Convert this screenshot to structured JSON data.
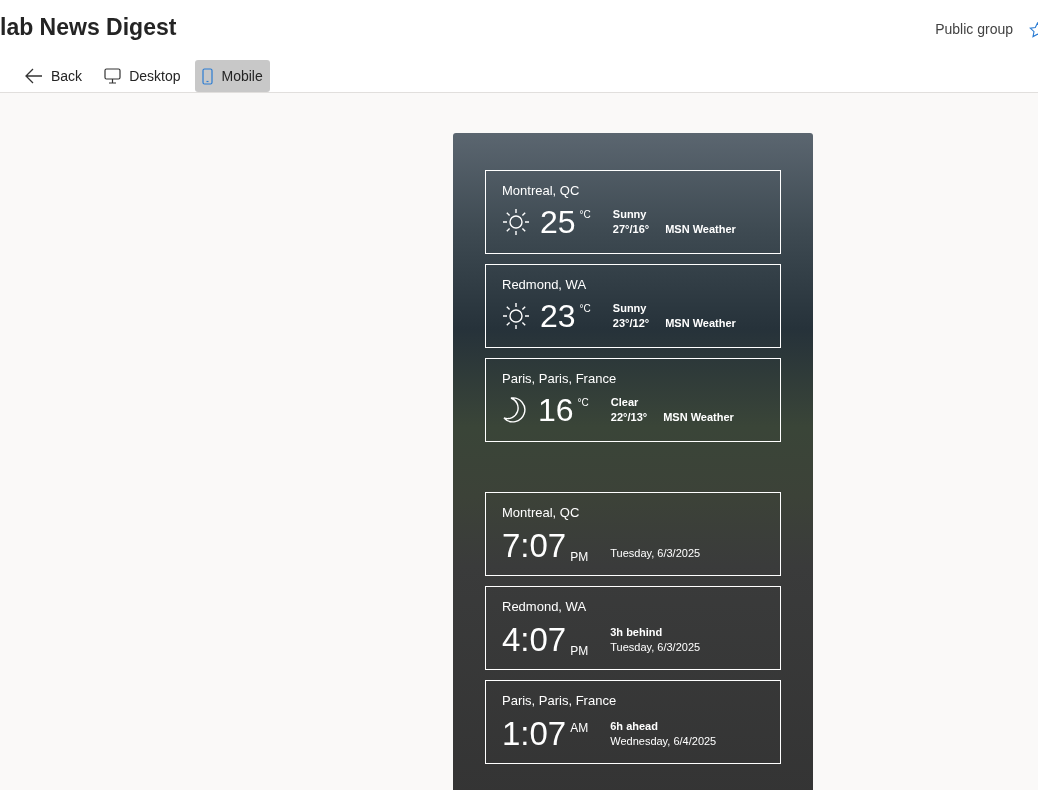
{
  "header": {
    "title": "lab News Digest",
    "visibility": "Public group",
    "favorite": false
  },
  "toolbar": [
    {
      "label": "Back",
      "kind": "back",
      "selected": false
    },
    {
      "label": "Desktop",
      "kind": "desktop",
      "selected": false
    },
    {
      "label": "Mobile",
      "kind": "mobile",
      "selected": true
    }
  ],
  "weather": [
    {
      "city": "Montreal, QC",
      "kind": "sun",
      "temp": "25",
      "unit": "°C",
      "condition": "Sunny",
      "range": "27°/16°",
      "source": "MSN Weather"
    },
    {
      "city": "Redmond, WA",
      "kind": "sun",
      "temp": "23",
      "unit": "°C",
      "condition": "Sunny",
      "range": "23°/12°",
      "source": "MSN Weather"
    },
    {
      "city": "Paris, Paris, France",
      "kind": "moon",
      "temp": "16",
      "unit": "°C",
      "condition": "Clear",
      "range": "22°/13°",
      "source": "MSN Weather"
    }
  ],
  "clocks": [
    {
      "city": "Montreal, QC",
      "time": "7:07",
      "meridiem": "PM",
      "meridiem_raised": false,
      "date": "Tuesday, 6/3/2025"
    },
    {
      "city": "Redmond, WA",
      "time": "4:07",
      "meridiem": "PM",
      "meridiem_raised": false,
      "offset": "3h behind",
      "date": "Tuesday, 6/3/2025"
    },
    {
      "city": "Paris, Paris, France",
      "time": "1:07",
      "meridiem": "AM",
      "meridiem_raised": true,
      "offset": "6h ahead",
      "date": "Wednesday, 6/4/2025"
    }
  ]
}
